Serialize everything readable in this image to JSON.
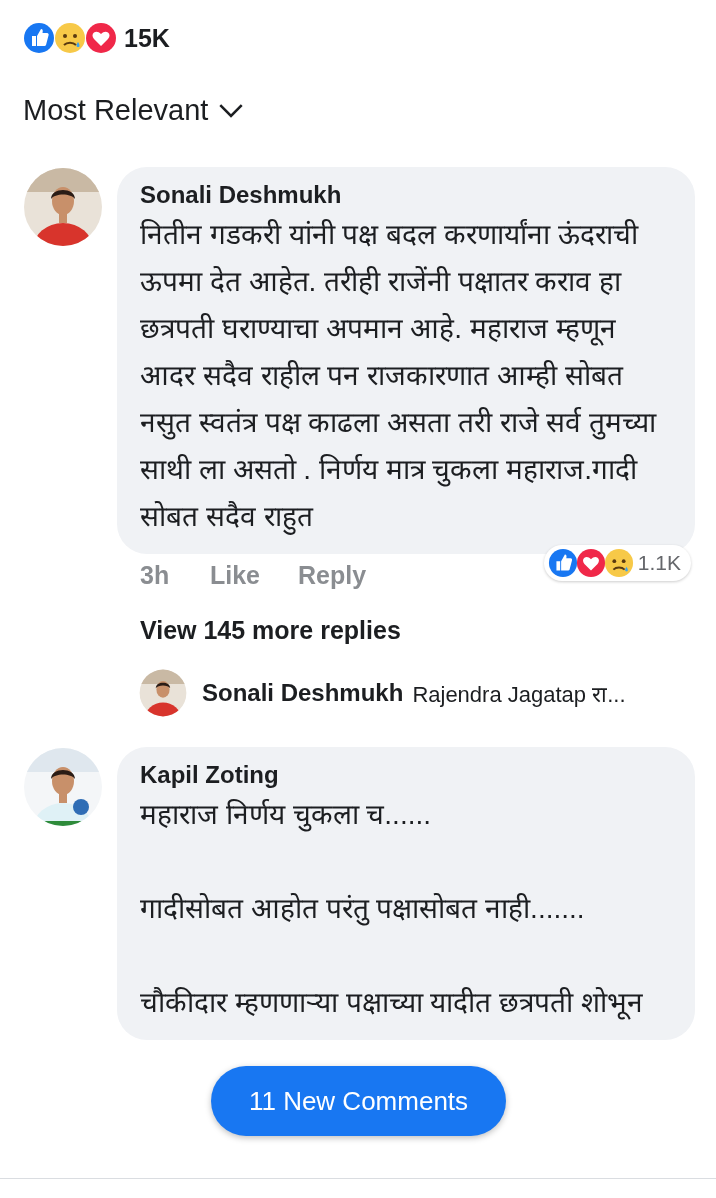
{
  "summary": {
    "reactions": [
      {
        "kind": "like"
      },
      {
        "kind": "sad"
      },
      {
        "kind": "love"
      }
    ],
    "count": "15K"
  },
  "sort": {
    "label": "Most Relevant"
  },
  "comments": [
    {
      "author": "Sonali Deshmukh",
      "paragraphs": [
        "नितीन गडकरी यांनी पक्ष बदल करणार्यांना ऊंदराची ऊपमा देत आहेत. तरीही राजेंनी पक्षातर कराव हा छत्रपती घराण्याचा अपमान आहे. महाराज म्हणून आदर सदैव राहील पन राजकारणात आम्ही सोबत नसुत स्वतंत्र पक्ष काढला असता तरी राजे सर्व तुमच्या साथी ला असतो . निर्णय मात्र चुकला महाराज.गादी सोबत सदैव राहुत"
      ],
      "time": "3h",
      "like": "Like",
      "reply": "Reply",
      "reactions": [
        {
          "kind": "like"
        },
        {
          "kind": "love"
        },
        {
          "kind": "sad"
        }
      ],
      "reaction_count": "1.1K",
      "more_replies": "View 145 more replies",
      "latest_reply": {
        "author": "Sonali Deshmukh",
        "text": "Rajendra Jagatap रा..."
      }
    },
    {
      "author": "Kapil Zoting",
      "paragraphs": [
        "महाराज निर्णय चुकला च......",
        "गादीसोबत आहोत परंतु पक्षासोबत नाही.......",
        "चौकीदार म्हणणाऱ्या पक्षाच्या यादीत छत्रपती शोभून"
      ]
    }
  ],
  "new_comments_button": "11 New Comments"
}
